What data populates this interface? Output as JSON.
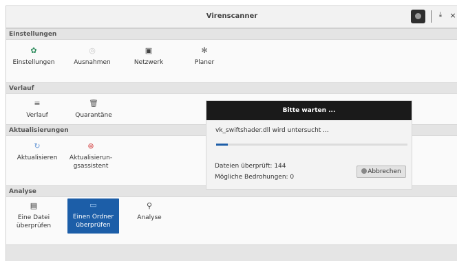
{
  "window": {
    "title": "Virenscanner",
    "minimize_glyph": "⤓",
    "close_glyph": "×"
  },
  "sections": {
    "settings": {
      "header": "Einstellungen",
      "items": [
        {
          "label": "Einstellungen",
          "icon": "settings-icon",
          "glyph": "✿"
        },
        {
          "label": "Ausnahmen",
          "icon": "exceptions-icon",
          "glyph": "◎"
        },
        {
          "label": "Netzwerk",
          "icon": "network-icon",
          "glyph": "▣"
        },
        {
          "label": "Planer",
          "icon": "scheduler-icon",
          "glyph": "✻"
        }
      ]
    },
    "history": {
      "header": "Verlauf",
      "items": [
        {
          "label": "Verlauf",
          "icon": "history-icon",
          "glyph": "≡"
        },
        {
          "label": "Quarantäne",
          "icon": "trash-icon",
          "glyph": "🗑"
        }
      ]
    },
    "updates": {
      "header": "Aktualisierungen",
      "items": [
        {
          "label": "Aktualisieren",
          "icon": "update-icon",
          "glyph": "↻"
        },
        {
          "label": "Aktualisierun-",
          "label2": "gsassistent",
          "icon": "lifebuoy-icon",
          "glyph": "⊛"
        }
      ]
    },
    "analysis": {
      "header": "Analyse",
      "items": [
        {
          "label": "Eine Datei",
          "label2": "überprüfen",
          "icon": "file-icon",
          "glyph": "▤"
        },
        {
          "label": "Einen Ordner",
          "label2": "überprüfen",
          "icon": "folder-icon",
          "glyph": "▭",
          "selected": true
        },
        {
          "label": "Analyse",
          "icon": "magnifier-icon",
          "glyph": "⚲"
        }
      ]
    }
  },
  "dialog": {
    "title": "Bitte warten ...",
    "current_file": "vk_swiftshader.dll wird untersucht ...",
    "progress": 0.06,
    "files_checked": "Dateien überprüft: 144",
    "threats": "Mögliche Bedrohungen: 0",
    "cancel_label": "Abbrechen"
  },
  "colors": {
    "accent": "#1c5ea8",
    "dialog_header": "#1a1a1a",
    "section_header": "#e4e4e4"
  }
}
